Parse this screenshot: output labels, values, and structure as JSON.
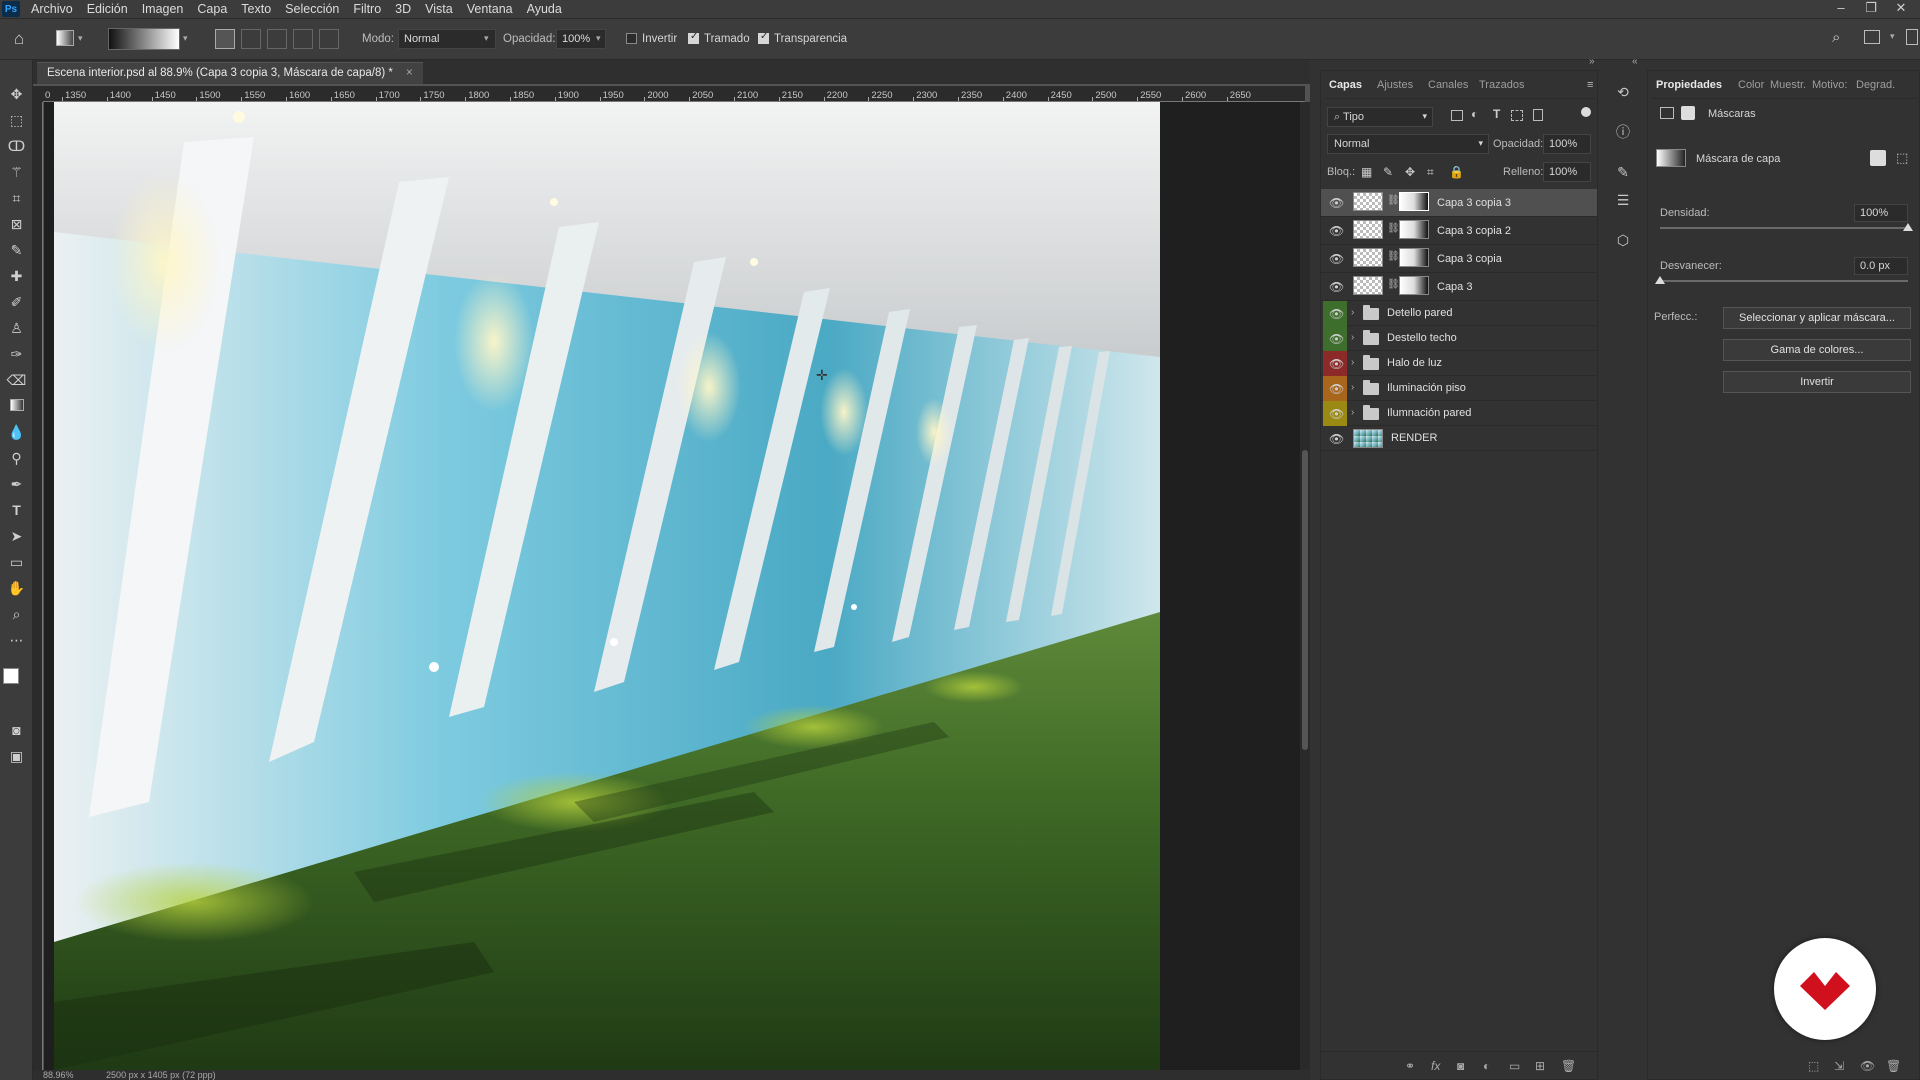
{
  "menubar": {
    "logo": "Ps",
    "items": [
      "Archivo",
      "Edición",
      "Imagen",
      "Capa",
      "Texto",
      "Selección",
      "Filtro",
      "3D",
      "Vista",
      "Ventana",
      "Ayuda"
    ]
  },
  "options": {
    "mode_label": "Modo:",
    "mode_value": "Normal",
    "opacity_label": "Opacidad:",
    "opacity_value": "100%",
    "invert_label": "Invertir",
    "invert_checked": false,
    "dither_label": "Tramado",
    "dither_checked": true,
    "transparency_label": "Transparencia",
    "transparency_checked": true
  },
  "document": {
    "tab_title": "Escena interior.psd al 88.9% (Capa 3 copia 3, Máscara de capa/8) *",
    "close": "×",
    "zoom_status": "88.96%",
    "size_status": "2500 px x 1405 px (72 ppp)"
  },
  "ruler": {
    "top_ticks": [
      "1350",
      "1400",
      "1450",
      "1500",
      "1550",
      "1600",
      "1650",
      "1700",
      "1750",
      "1800",
      "1850",
      "1900",
      "1950",
      "2000",
      "2050",
      "2100",
      "2150",
      "2200",
      "2250",
      "2300",
      "2350",
      "2400",
      "2450",
      "2500",
      "2550",
      "2600",
      "2650"
    ],
    "origin": "0"
  },
  "layers_panel": {
    "tabs": [
      "Capas",
      "Ajustes",
      "Canales",
      "Trazados"
    ],
    "active_tab": "Capas",
    "filter_label": "Tipo",
    "blend_mode": "Normal",
    "opacity_label": "Opacidad:",
    "opacity_value": "100%",
    "lock_label": "Bloq.:",
    "fill_label": "Relleno:",
    "fill_value": "100%",
    "layers": [
      {
        "name": "Capa 3 copia 3",
        "kind": "masked",
        "selected": true,
        "eye_color": ""
      },
      {
        "name": "Capa 3 copia 2",
        "kind": "masked",
        "selected": false,
        "eye_color": ""
      },
      {
        "name": "Capa 3 copia",
        "kind": "masked",
        "selected": false,
        "eye_color": ""
      },
      {
        "name": "Capa 3",
        "kind": "masked",
        "selected": false,
        "eye_color": ""
      },
      {
        "name": "Detello pared",
        "kind": "group",
        "selected": false,
        "eye_color": "#3d6e2b"
      },
      {
        "name": "Destello techo",
        "kind": "group",
        "selected": false,
        "eye_color": "#3d6e2b"
      },
      {
        "name": "Halo de luz",
        "kind": "group",
        "selected": false,
        "eye_color": "#8c2a2a"
      },
      {
        "name": "Iluminación piso",
        "kind": "group",
        "selected": false,
        "eye_color": "#a8651c"
      },
      {
        "name": "Ilumnación pared",
        "kind": "group",
        "selected": false,
        "eye_color": "#9a8a14"
      },
      {
        "name": "RENDER",
        "kind": "image",
        "selected": false,
        "eye_color": ""
      }
    ]
  },
  "properties_panel": {
    "tabs": [
      "Propiedades",
      "Color",
      "Muestr.",
      "Motivo:",
      "Degrad."
    ],
    "active_tab": "Propiedades",
    "section_label": "Máscaras",
    "mask_label": "Máscara de capa",
    "density_label": "Densidad:",
    "density_value": "100%",
    "density_level": 1.0,
    "feather_label": "Desvanecer:",
    "feather_value": "0.0 px",
    "feather_level": 0.0,
    "refine_label": "Perfecc.:",
    "buttons": [
      "Seleccionar y aplicar máscara...",
      "Gama de colores...",
      "Invertir"
    ]
  },
  "colors": {
    "accent": "#31a8ff",
    "badge_red": "#d0101d"
  }
}
